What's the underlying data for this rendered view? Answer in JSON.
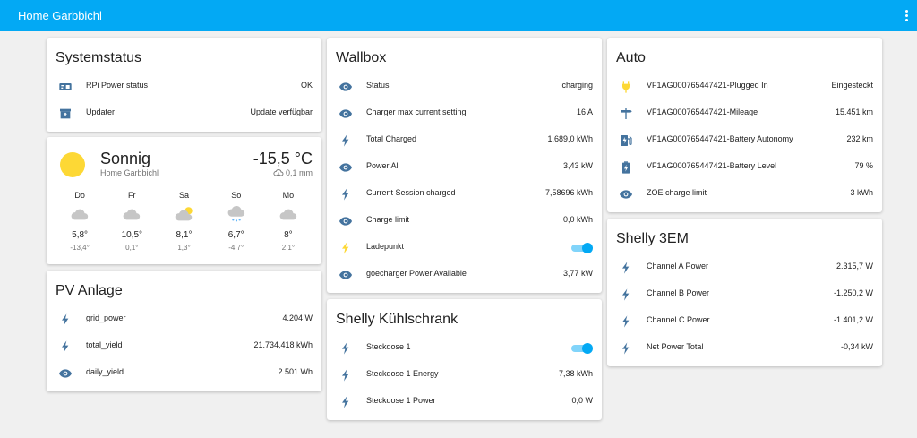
{
  "app": {
    "title": "Home Garbbichl"
  },
  "colors": {
    "accent": "#03a9f4",
    "icon": "#44739e",
    "bolt": "#fdd835",
    "sun": "#fdd835"
  },
  "systemstatus": {
    "title": "Systemstatus",
    "rows": [
      {
        "icon": "power-status-icon",
        "label": "RPi Power status",
        "value": "OK"
      },
      {
        "icon": "package-up-icon",
        "label": "Updater",
        "value": "Update verfügbar"
      }
    ]
  },
  "weather": {
    "condition": "Sonnig",
    "location": "Home Garbbichl",
    "temperature": "-15,5 °C",
    "precipitation": "0,1 mm",
    "forecast": [
      {
        "day": "Do",
        "icon": "cloud-icon",
        "high": "5,8°",
        "low": "-13,4°"
      },
      {
        "day": "Fr",
        "icon": "cloud-icon",
        "high": "10,5°",
        "low": "0,1°"
      },
      {
        "day": "Sa",
        "icon": "partly-cloudy-icon",
        "high": "8,1°",
        "low": "1,3°"
      },
      {
        "day": "So",
        "icon": "snowy-icon",
        "high": "6,7°",
        "low": "-4,7°"
      },
      {
        "day": "Mo",
        "icon": "cloud-icon",
        "high": "8°",
        "low": "2,1°"
      }
    ]
  },
  "pv": {
    "title": "PV Anlage",
    "rows": [
      {
        "icon": "flash-icon",
        "label": "grid_power",
        "value": "4.204 W"
      },
      {
        "icon": "flash-icon",
        "label": "total_yield",
        "value": "21.734,418 kWh"
      },
      {
        "icon": "eye-icon",
        "label": "daily_yield",
        "value": "2.501 Wh"
      }
    ]
  },
  "wallbox": {
    "title": "Wallbox",
    "rows": [
      {
        "icon": "eye-icon",
        "label": "Status",
        "value": "charging"
      },
      {
        "icon": "eye-icon",
        "label": "Charger max current setting",
        "value": "16 A"
      },
      {
        "icon": "flash-icon",
        "label": "Total Charged",
        "value": "1.689,0 kWh"
      },
      {
        "icon": "eye-icon",
        "label": "Power All",
        "value": "3,43 kW"
      },
      {
        "icon": "flash-icon",
        "label": "Current Session charged",
        "value": "7,58696 kWh"
      },
      {
        "icon": "eye-icon",
        "label": "Charge limit",
        "value": "0,0 kWh"
      },
      {
        "icon": "flash-yellow-icon",
        "label": "Ladepunkt",
        "toggle": true
      },
      {
        "icon": "eye-icon",
        "label": "goecharger Power Available",
        "value": "3,77 kW"
      }
    ]
  },
  "shelly_fridge": {
    "title": "Shelly Kühlschrank",
    "rows": [
      {
        "icon": "flash-icon",
        "label": "Steckdose 1",
        "toggle": true
      },
      {
        "icon": "flash-icon",
        "label": "Steckdose 1 Energy",
        "value": "7,38 kWh"
      },
      {
        "icon": "flash-icon",
        "label": "Steckdose 1 Power",
        "value": "0,0 W"
      }
    ]
  },
  "auto": {
    "title": "Auto",
    "rows": [
      {
        "icon": "ev-plug-icon",
        "label": "VF1AG000765447421-Plugged In",
        "value": "Eingesteckt"
      },
      {
        "icon": "mileage-icon",
        "label": "VF1AG000765447421-Mileage",
        "value": "15.451 km"
      },
      {
        "icon": "ev-station-icon",
        "label": "VF1AG000765447421-Battery Autonomy",
        "value": "232 km"
      },
      {
        "icon": "battery-charging-icon",
        "label": "VF1AG000765447421-Battery Level",
        "value": "79 %"
      },
      {
        "icon": "eye-icon",
        "label": "ZOE charge limit",
        "value": "3 kWh"
      }
    ]
  },
  "shelly3em": {
    "title": "Shelly 3EM",
    "rows": [
      {
        "icon": "flash-icon",
        "label": "Channel A Power",
        "value": "2.315,7 W"
      },
      {
        "icon": "flash-icon",
        "label": "Channel B Power",
        "value": "-1.250,2 W"
      },
      {
        "icon": "flash-icon",
        "label": "Channel C Power",
        "value": "-1.401,2 W"
      },
      {
        "icon": "flash-icon",
        "label": "Net Power Total",
        "value": "-0,34 kW"
      }
    ]
  }
}
